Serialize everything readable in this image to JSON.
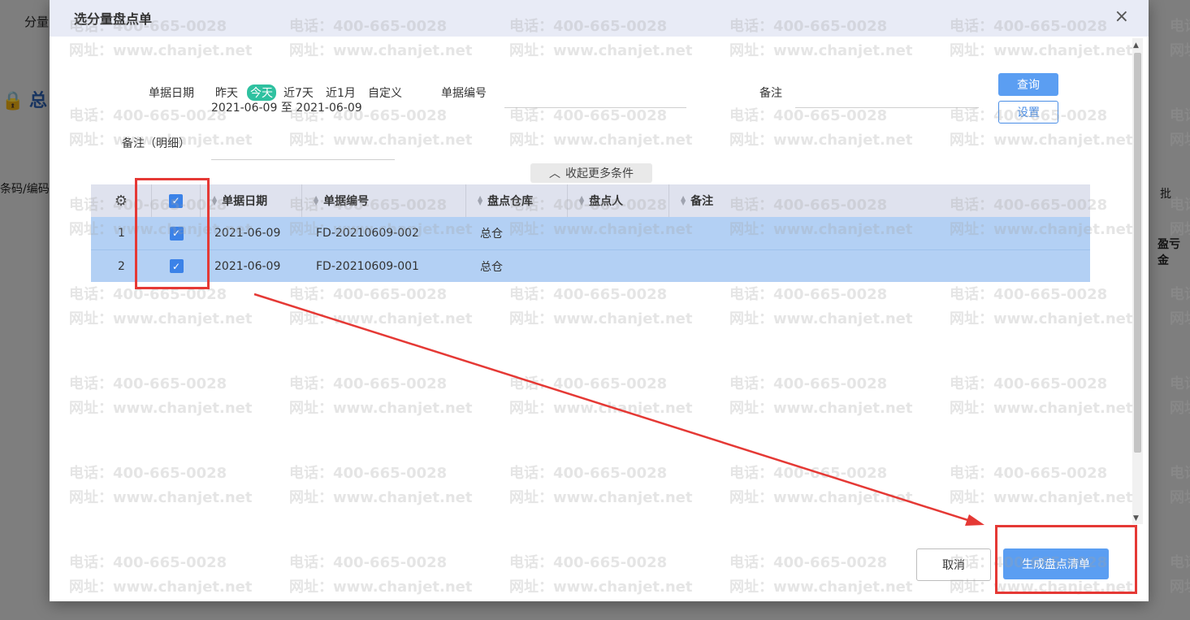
{
  "background": {
    "top_left_text": "分量",
    "heading_fragment": "总",
    "search_fragment": "条码/编码",
    "batch_fragment": "批",
    "column_fragment": "盈亏金"
  },
  "dialog": {
    "title": "选分量盘点单",
    "close_symbol": "×"
  },
  "filters": {
    "date_label": "单据日期",
    "quick_dates": [
      "昨天",
      "今天",
      "近7天",
      "近1月",
      "自定义"
    ],
    "active_quick_date": "今天",
    "date_from": "2021-06-09",
    "date_sep": "至",
    "date_to": "2021-06-09",
    "doc_no_label": "单据编号",
    "doc_no_value": "",
    "remark_label": "备注",
    "remark_value": "",
    "remark_detail_label": "备注（明细）",
    "remark_detail_value": "",
    "query_button": "查询",
    "settings_button": "设置",
    "collapse_label": "收起更多条件"
  },
  "table": {
    "columns": [
      "单据日期",
      "单据编号",
      "盘点仓库",
      "盘点人",
      "备注"
    ],
    "rows": [
      {
        "index": "1",
        "checked": true,
        "date": "2021-06-09",
        "doc_no": "FD-20210609-002",
        "warehouse": "总仓",
        "counter": "",
        "remark": ""
      },
      {
        "index": "2",
        "checked": true,
        "date": "2021-06-09",
        "doc_no": "FD-20210609-001",
        "warehouse": "总仓",
        "counter": "",
        "remark": ""
      }
    ]
  },
  "footer": {
    "cancel_button": "取消",
    "generate_button": "生成盘点清单"
  },
  "watermark": {
    "phone": "电话：400-665-0028",
    "website": "网址：www.chanjet.net"
  },
  "colors": {
    "primary": "#5b9ef2",
    "active_date": "#2fc1a0",
    "selected_row": "#b3d0f4",
    "annotation": "#e53935"
  }
}
